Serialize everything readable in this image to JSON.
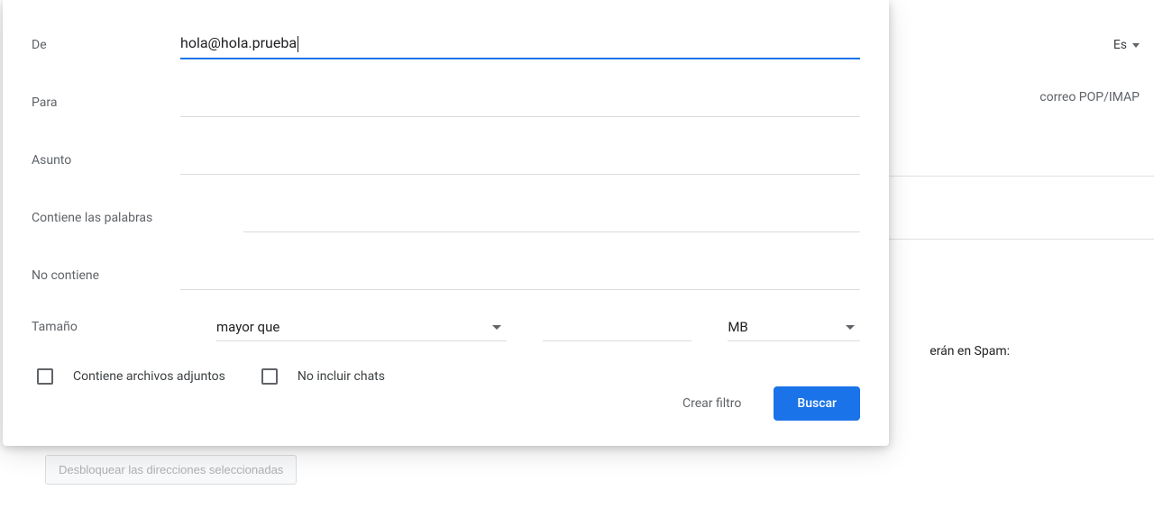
{
  "background": {
    "language": "Es",
    "tab_label": "correo POP/IMAP",
    "spam_text": "erán en Spam:",
    "unblock_button": "Desbloquear las direcciones seleccionadas"
  },
  "dialog": {
    "fields": {
      "from_label": "De",
      "from_value": "hola@hola.prueba",
      "to_label": "Para",
      "to_value": "",
      "subject_label": "Asunto",
      "subject_value": "",
      "has_words_label": "Contiene las palabras",
      "has_words_value": "",
      "not_has_label": "No contiene",
      "not_has_value": ""
    },
    "size": {
      "label": "Tamaño",
      "operator": "mayor que",
      "amount": "",
      "unit": "MB"
    },
    "checkboxes": {
      "attachments_label": "Contiene archivos adjuntos",
      "exclude_chats_label": "No incluir chats"
    },
    "actions": {
      "create_filter": "Crear filtro",
      "search": "Buscar"
    }
  }
}
